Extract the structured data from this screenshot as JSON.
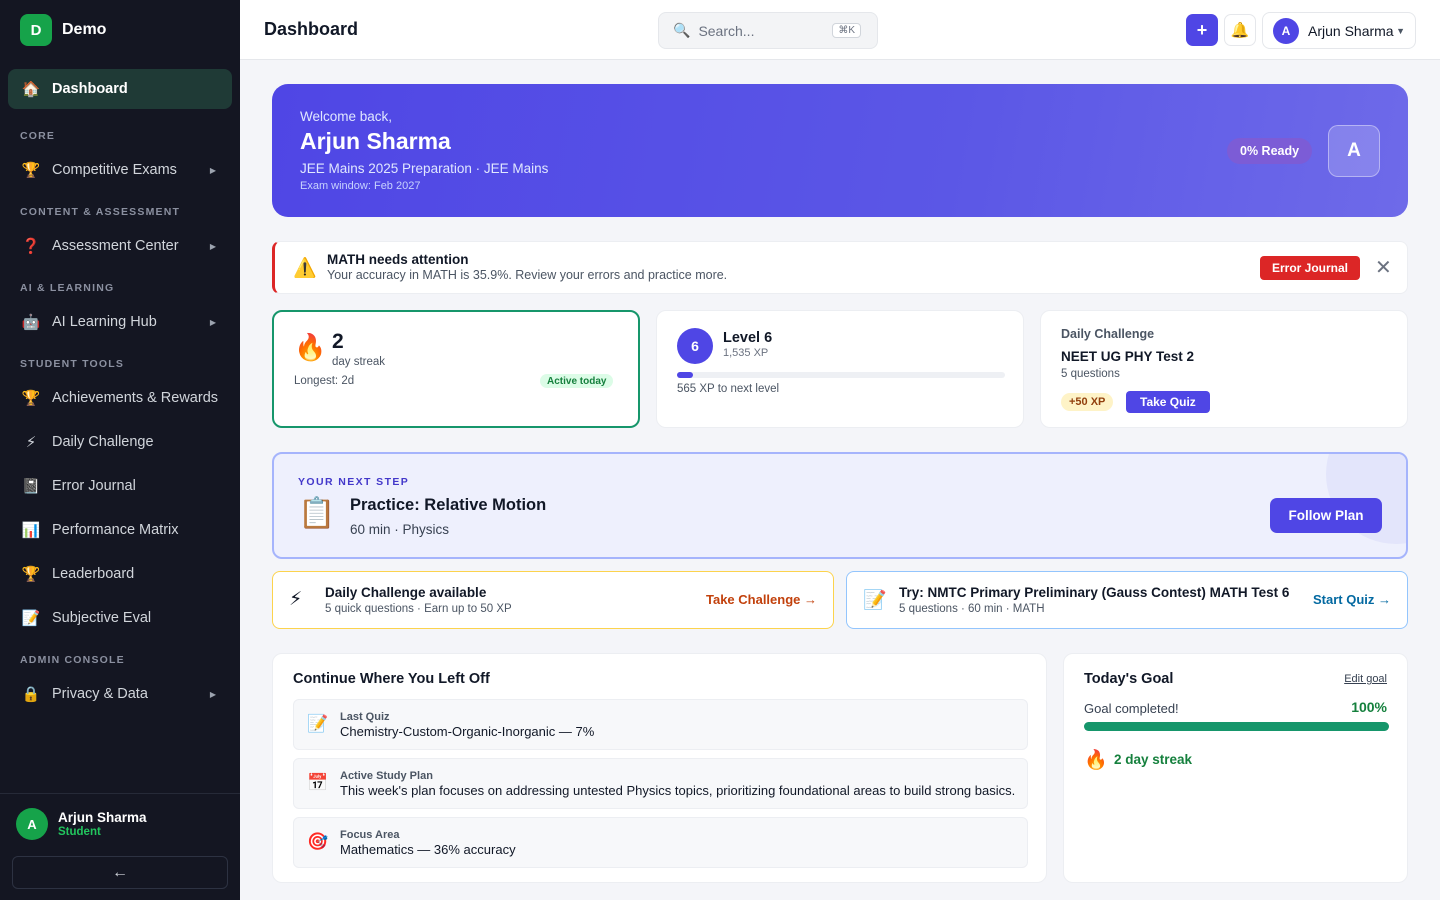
{
  "brand": {
    "logo_letter": "D",
    "name": "Demo"
  },
  "sidebar": {
    "items": [
      {
        "label": "Dashboard",
        "icon": "🏠",
        "icon_name": "home-icon"
      },
      {
        "label": "Competitive Exams",
        "icon": "🏆",
        "icon_name": "trophy-icon"
      },
      {
        "label": "Assessment Center",
        "icon": "❓",
        "icon_name": "question-icon"
      },
      {
        "label": "AI Learning Hub",
        "icon": "🤖",
        "icon_name": "robot-icon"
      },
      {
        "label": "Achievements & Rewards",
        "icon": "🏆",
        "icon_name": "trophy-icon"
      },
      {
        "label": "Daily Challenge",
        "icon": "⚡",
        "icon_name": "lightning-icon"
      },
      {
        "label": "Error Journal",
        "icon": "📓",
        "icon_name": "notebook-icon"
      },
      {
        "label": "Performance Matrix",
        "icon": "📊",
        "icon_name": "bar-chart-icon"
      },
      {
        "label": "Leaderboard",
        "icon": "🏆",
        "icon_name": "trophy-icon"
      },
      {
        "label": "Subjective Eval",
        "icon": "📝",
        "icon_name": "memo-icon"
      },
      {
        "label": "Privacy & Data",
        "icon": "🔒",
        "icon_name": "lock-icon"
      }
    ],
    "sections": [
      "CORE",
      "CONTENT & ASSESSMENT",
      "AI & LEARNING",
      "STUDENT TOOLS",
      "ADMIN CONSOLE"
    ],
    "user": {
      "initial": "A",
      "name": "Arjun Sharma",
      "role": "Student"
    },
    "collapse_icon": "←"
  },
  "header": {
    "title": "Dashboard",
    "search_placeholder": "Search...",
    "search_icon": "🔍",
    "shortcut": "⌘K",
    "add_icon": "+",
    "bell_icon": "🔔",
    "user_initial": "A",
    "user_name": "Arjun Sharma",
    "caret": "▼"
  },
  "hero": {
    "welcome": "Welcome back,",
    "name": "Arjun Sharma",
    "subtitle": "JEE Mains 2025 Preparation · JEE Mains",
    "exam_window": "Exam window: Feb 2027",
    "ready": "0% Ready",
    "avatar_initial": "A"
  },
  "alert": {
    "icon": "⚠️",
    "title": "MATH needs attention",
    "text": "Your accuracy in MATH is 35.9%. Review your errors and practice more.",
    "button": "Error Journal",
    "close": "✕"
  },
  "streak": {
    "icon": "🔥",
    "count": "2",
    "label": "day streak",
    "longest": "Longest: 2d",
    "badge": "Active today"
  },
  "level": {
    "number": "6",
    "title": "Level 6",
    "xp": "1,535 XP",
    "progress": 0.05,
    "next": "565 XP to next level"
  },
  "daily": {
    "label": "Daily Challenge",
    "title": "NEET UG PHY Test 2",
    "questions": "5 questions",
    "xp": "+50 XP",
    "button": "Take Quiz"
  },
  "next_step": {
    "label": "YOUR NEXT STEP",
    "icon": "📋",
    "title": "Practice: Relative Motion",
    "sub": "60 min · Physics",
    "button": "Follow Plan"
  },
  "suggestions": [
    {
      "icon": "⚡",
      "title": "Daily Challenge available",
      "sub": "5 quick questions · Earn up to 50 XP",
      "link": "Take Challenge →"
    },
    {
      "icon": "📝",
      "title": "Try: NMTC Primary Preliminary (Gauss Contest) MATH Test 6",
      "sub": "5 questions · 60 min · MATH",
      "link": "Start Quiz →"
    }
  ],
  "continue": {
    "title": "Continue Where You Left Off",
    "items": [
      {
        "icon": "📝",
        "label": "Last Quiz",
        "value": "Chemistry-Custom-Organic-Inorganic — 7%"
      },
      {
        "icon": "📅",
        "label": "Active Study Plan",
        "value": "This week's plan focuses on addressing untested Physics topics, prioritizing foundational areas to build strong basics."
      },
      {
        "icon": "🎯",
        "label": "Focus Area",
        "value": "Mathematics — 36% accuracy"
      }
    ]
  },
  "goal": {
    "title": "Today's Goal",
    "edit": "Edit goal",
    "status": "Goal completed!",
    "percent": "100%",
    "progress": 1.0,
    "fire": "🔥",
    "streak": "2 day streak"
  }
}
